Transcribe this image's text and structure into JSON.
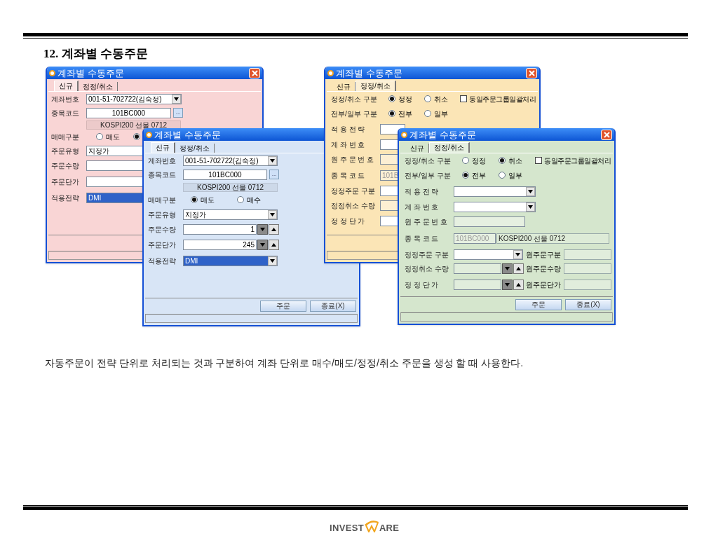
{
  "heading": "12. 계좌별 수동주문",
  "windows": [
    {
      "title": "계좌별 수동주문",
      "color": "#f9d5d5",
      "tabs": [
        {
          "label": "신규",
          "selected": true
        },
        {
          "label": "정정/취소",
          "selected": false
        }
      ],
      "rows": [
        {
          "kind": "select",
          "label": "계좌번호",
          "value": "001-51-702722(김숙정)",
          "highlighted": false
        },
        {
          "kind": "code",
          "label": "종목코드",
          "value": "101BC000",
          "button": "..."
        },
        {
          "kind": "caption",
          "value": "KOSPI200 선물 0712"
        },
        {
          "kind": "radio",
          "label": "매매구분",
          "options": [
            {
              "label": "매도",
              "selected": false
            },
            {
              "selected": true
            }
          ]
        },
        {
          "kind": "text",
          "label": "주문유형",
          "value": "지정가",
          "highlighted": false,
          "disabled": false
        },
        {
          "kind": "text",
          "label": "주문수량",
          "disabled": false
        },
        {
          "kind": "text",
          "label": "주문단가",
          "disabled": false
        },
        {
          "kind": "text",
          "label": "적용전략",
          "value": "DMI",
          "highlighted": true,
          "disabled": false
        }
      ]
    },
    {
      "title": "계좌별 수동주문",
      "color": "#d8e5f6",
      "tabs": [
        {
          "label": "신규",
          "selected": true
        },
        {
          "label": "정정/취소",
          "selected": false
        }
      ],
      "rows": [
        {
          "kind": "select",
          "label": "계좌번호",
          "value": "001-51-702722(김숙정)",
          "highlighted": false
        },
        {
          "kind": "code",
          "label": "종목코드",
          "value": "101BC000",
          "button": "..."
        },
        {
          "kind": "caption",
          "value": "KOSPI200 선물 0712"
        },
        {
          "kind": "radio",
          "label": "매매구분",
          "options": [
            {
              "label": "매도",
              "selected": true
            },
            {
              "label": "매수",
              "selected": false
            }
          ]
        },
        {
          "kind": "select",
          "label": "주문유형",
          "value": "지정가",
          "highlighted": false
        },
        {
          "kind": "spin",
          "label": "주문수량",
          "value": "1",
          "disabled": false
        },
        {
          "kind": "spin",
          "label": "주문단가",
          "value": "245",
          "disabled": false
        },
        {
          "kind": "select",
          "label": "적용전략",
          "value": "DMI",
          "highlighted": true
        }
      ],
      "buttons": [
        "주문",
        "종료(X)"
      ]
    },
    {
      "title": "계좌별 수동주문",
      "color": "#fbe5b6",
      "tabs": [
        {
          "label": "신규",
          "selected": false
        },
        {
          "label": "정정/취소",
          "selected": true
        }
      ],
      "rows": [
        {
          "kind": "radio",
          "label": "정정/취소 구분",
          "options": [
            {
              "label": "정정",
              "selected": true
            },
            {
              "label": "취소",
              "selected": false
            }
          ],
          "checkbox": {
            "label": "동일주문그룹일괄처리",
            "checked": false
          }
        },
        {
          "kind": "radio",
          "label": "전부/일부 구분",
          "options": [
            {
              "label": "전부",
              "selected": true
            },
            {
              "label": "일부",
              "selected": false
            }
          ]
        },
        {
          "kind": "text",
          "label": "적 용 전 략",
          "disabled": false
        },
        {
          "kind": "text",
          "label": "계 좌 번 호",
          "disabled": false
        },
        {
          "kind": "text",
          "label": "원 주 문 번 호",
          "disabled": true
        },
        {
          "kind": "text",
          "label": "종 목 코 드",
          "value": "101B",
          "disabled": true
        },
        {
          "kind": "text",
          "label": "정정주문 구분",
          "disabled": false
        },
        {
          "kind": "text",
          "label": "정정취소 수량",
          "disabled": true
        },
        {
          "kind": "text",
          "label": "정 정 단 가",
          "disabled": false
        }
      ]
    },
    {
      "title": "계좌별 수동주문",
      "color": "#d5e6cd",
      "tabs": [
        {
          "label": "신규",
          "selected": false
        },
        {
          "label": "정정/취소",
          "selected": true
        }
      ],
      "rows": [
        {
          "kind": "radio",
          "label": "정정/취소 구분",
          "options": [
            {
              "label": "정정",
              "selected": false
            },
            {
              "label": "취소",
              "selected": true
            }
          ],
          "checkbox": {
            "label": "동일주문그룹일괄처리",
            "checked": false
          }
        },
        {
          "kind": "radio",
          "label": "전부/일부 구분",
          "options": [
            {
              "label": "전부",
              "selected": true
            },
            {
              "label": "일부",
              "selected": false
            }
          ]
        },
        {
          "kind": "select",
          "label": "적 용 전 략"
        },
        {
          "kind": "select",
          "label": "계 좌 번 호"
        },
        {
          "kind": "text",
          "label": "원 주 문 번 호",
          "disabled": true
        },
        {
          "kind": "text",
          "label": "종 목 코 드",
          "value": "101BC000",
          "disabled": true,
          "caption": "KOSPI200 선물 0712"
        },
        {
          "kind": "select",
          "label": "정정주문 구분",
          "side": "원주문구분"
        },
        {
          "kind": "spin",
          "label": "정정취소 수량",
          "disabled": true,
          "side": "원주문수량"
        },
        {
          "kind": "spin",
          "label": "정 정 단 가",
          "disabled": true,
          "side": "원주문단가"
        }
      ],
      "buttons": [
        "주문",
        "종료(X)"
      ]
    }
  ],
  "description": "자동주문이 전략 단위로 처리되는 것과 구분하여 계좌 단위로 매수/매도/정정/취소 주문을 생성 할 때 사용한다.",
  "logo": {
    "before": "INVEST",
    "after": "ARE"
  }
}
